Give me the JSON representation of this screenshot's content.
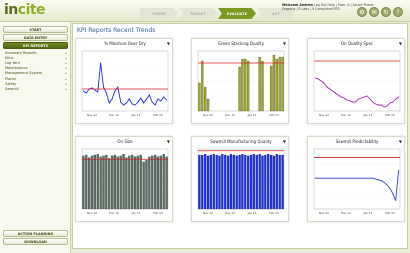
{
  "app": {
    "logo_part1": "in",
    "logo_part2": "cite"
  },
  "steps": [
    {
      "label": "STAGE",
      "active": false
    },
    {
      "label": "TARGET",
      "active": false
    },
    {
      "label": "EVALUATE",
      "active": true
    },
    {
      "label": "ACT",
      "active": false
    }
  ],
  "header": {
    "welcome": "Welcome Andrew",
    "welcome_rest": " Log Out Help | Pack: A | Active Phase: ",
    "welcome_line2": "Ongoing | 6 Labs | 9 Completed PFD"
  },
  "header_icons": [
    {
      "name": "settings-icon",
      "glyph": "⚙"
    },
    {
      "name": "mail-icon",
      "glyph": "✉"
    },
    {
      "name": "refresh-icon",
      "glyph": "↻"
    },
    {
      "name": "help-icon",
      "glyph": "?"
    }
  ],
  "sidebar": {
    "start_label": "START",
    "data_entry_label": "DATA ENTRY",
    "kpi_label": "KPI REPORTS",
    "items": [
      "Summary Reports",
      "Kilns",
      "Log Yard",
      "Maintenance",
      "Management System",
      "Planer",
      "Safety",
      "Sawmill"
    ],
    "action_label": "ACTION PLANNING",
    "download_label": "DOWNLOAD"
  },
  "main": {
    "title": "KPI Reports Recent Trends"
  },
  "chart_data": [
    {
      "type": "line",
      "title": "% Moisture Over Dry",
      "color": "#1c2fd8",
      "x_ticks": [
        "Nov 12",
        "Dec 12",
        "Jan 13",
        "Feb 13"
      ],
      "values": [
        20,
        18,
        22,
        23,
        21,
        19,
        48,
        24,
        18,
        8,
        12,
        20,
        24,
        9,
        6,
        8,
        12,
        7,
        6,
        9,
        13,
        8,
        12,
        16,
        9,
        6,
        12,
        10,
        14,
        11
      ],
      "target": 22,
      "ylim": [
        0,
        60
      ]
    },
    {
      "type": "bar",
      "title": "Green Stacking Quality",
      "color": "#a0a62a",
      "x_ticks": [
        "Nov 12",
        "Dec 12",
        "Jan 13",
        "Feb 13"
      ],
      "values": [
        28,
        50,
        24,
        12,
        0,
        0,
        0,
        0,
        0,
        0,
        0,
        0,
        0,
        0,
        44,
        52,
        52,
        50,
        0,
        0,
        0,
        54,
        50,
        0,
        0,
        45,
        56,
        52,
        54,
        54
      ],
      "target": 48,
      "ylim": [
        0,
        60
      ]
    },
    {
      "type": "line",
      "title": "On Quality Spec",
      "color": "#9e2aa8",
      "x_ticks": [
        "Nov 12",
        "Dec 12",
        "Jan 13",
        "Feb 13"
      ],
      "values": [
        33,
        32,
        30,
        28,
        24,
        22,
        20,
        18,
        16,
        14,
        13,
        11,
        10,
        9,
        9,
        12,
        13,
        14,
        15,
        12,
        9,
        7,
        6,
        6,
        4,
        5,
        8,
        9,
        12,
        14
      ],
      "target": 50,
      "ylim": [
        0,
        60
      ]
    },
    {
      "type": "bar",
      "title": "On Size",
      "color": "#5a6e64",
      "x_ticks": [
        "Nov 12",
        "Dec 12",
        "Jan 13",
        "Feb 13"
      ],
      "values": [
        62,
        63,
        60,
        62,
        63,
        64,
        61,
        62,
        63,
        59,
        62,
        63,
        61,
        62,
        64,
        60,
        62,
        63,
        61,
        62,
        63,
        55,
        57,
        61,
        62,
        63,
        61,
        62,
        64,
        61
      ],
      "target": 58,
      "ylim": [
        0,
        70
      ]
    },
    {
      "type": "bar",
      "title": "Sawmill Manufacturing Quality",
      "color": "#1c2fe8",
      "x_ticks": [
        "Nov 12",
        "Dec 12",
        "Jan 13",
        "Feb 13"
      ],
      "values": [
        63,
        63,
        64,
        62,
        63,
        64,
        63,
        62,
        64,
        63,
        62,
        64,
        63,
        62,
        63,
        64,
        63,
        62,
        63,
        64,
        63,
        64,
        62,
        63,
        64,
        63,
        62,
        64,
        63,
        63
      ],
      "target": 68,
      "ylim": [
        0,
        70
      ]
    },
    {
      "type": "line",
      "title": "Sawmill Predictability",
      "color": "#3346cc",
      "x_ticks": [
        "Nov 12",
        "Dec 12",
        "Jan 13",
        "Feb 13"
      ],
      "values": [
        36,
        36,
        36,
        36,
        36,
        36,
        36,
        36,
        36,
        36,
        36,
        36,
        36,
        36,
        36,
        36,
        36,
        36,
        36,
        36,
        36,
        35,
        34,
        33,
        31,
        28,
        24,
        18,
        10,
        45
      ],
      "target": 60,
      "ylim": [
        0,
        70
      ]
    }
  ],
  "colors": {
    "accent": "#7b9a22",
    "target_line": "#d42020",
    "title": "#2f5d9a"
  }
}
